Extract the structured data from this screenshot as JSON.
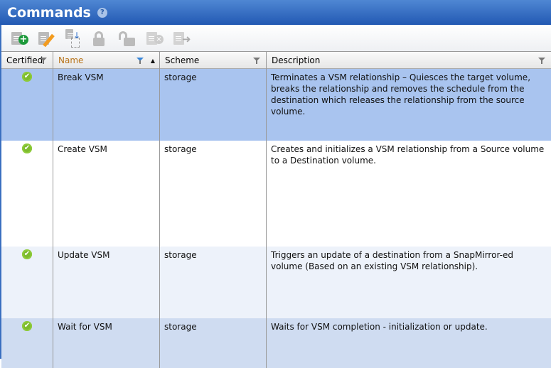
{
  "header": {
    "title": "Commands",
    "help_icon": "?"
  },
  "toolbar": [
    {
      "name": "add-command-button",
      "icon": "doc-plus-icon"
    },
    {
      "name": "edit-command-button",
      "icon": "doc-pencil-icon"
    },
    {
      "name": "import-command-button",
      "icon": "doc-import-icon"
    },
    {
      "name": "lock-button",
      "icon": "lock-icon"
    },
    {
      "name": "unlock-button",
      "icon": "unlock-icon"
    },
    {
      "name": "delete-command-button",
      "icon": "doc-delete-icon"
    },
    {
      "name": "export-command-button",
      "icon": "doc-export-icon"
    }
  ],
  "columns": {
    "certified": "Certified",
    "name": "Name",
    "scheme": "Scheme",
    "description": "Description",
    "sort_indicator": "▲"
  },
  "rows": [
    {
      "certified": "✔",
      "name": "Break VSM",
      "scheme": "storage",
      "description": "Terminates a VSM relationship – Quiesces the target volume, breaks the relationship and removes the schedule from the destination which releases the relationship from the source volume."
    },
    {
      "certified": "✔",
      "name": "Create VSM",
      "scheme": "storage",
      "description": "Creates and initializes a VSM relationship from a Source volume to a Destination volume."
    },
    {
      "certified": "✔",
      "name": "Update VSM",
      "scheme": "storage",
      "description": "Triggers an update of a destination from a SnapMirror-ed volume (Based on an existing VSM relationship)."
    },
    {
      "certified": "✔",
      "name": "Wait for VSM",
      "scheme": "storage",
      "description": "Waits for VSM completion - initialization or update."
    }
  ],
  "colors": {
    "selected": "#a9c4ef",
    "white": "#ffffff",
    "alt": "#edf2fa",
    "alt2": "#cfdcf1"
  }
}
